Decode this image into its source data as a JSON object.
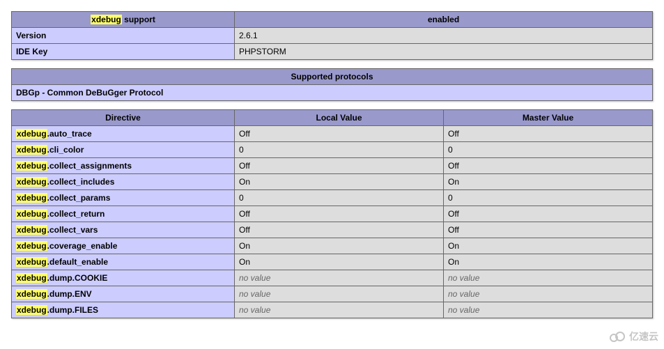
{
  "hl_prefix": "xdebug",
  "support_table": {
    "header_left_suffix": " support",
    "header_right": "enabled",
    "rows": [
      {
        "key": "Version",
        "value": "2.6.1"
      },
      {
        "key": "IDE Key",
        "value": "PHPSTORM"
      }
    ]
  },
  "protocols_table": {
    "header": "Supported protocols",
    "row": "DBGp - Common DeBuGger Protocol"
  },
  "directives_table": {
    "headers": [
      "Directive",
      "Local Value",
      "Master Value"
    ],
    "rows": [
      {
        "suffix": ".auto_trace",
        "local": "Off",
        "master": "Off"
      },
      {
        "suffix": ".cli_color",
        "local": "0",
        "master": "0"
      },
      {
        "suffix": ".collect_assignments",
        "local": "Off",
        "master": "Off"
      },
      {
        "suffix": ".collect_includes",
        "local": "On",
        "master": "On"
      },
      {
        "suffix": ".collect_params",
        "local": "0",
        "master": "0"
      },
      {
        "suffix": ".collect_return",
        "local": "Off",
        "master": "Off"
      },
      {
        "suffix": ".collect_vars",
        "local": "Off",
        "master": "Off"
      },
      {
        "suffix": ".coverage_enable",
        "local": "On",
        "master": "On"
      },
      {
        "suffix": ".default_enable",
        "local": "On",
        "master": "On"
      },
      {
        "suffix": ".dump.COOKIE",
        "local": "no value",
        "master": "no value",
        "italic": true
      },
      {
        "suffix": ".dump.ENV",
        "local": "no value",
        "master": "no value",
        "italic": true
      },
      {
        "suffix": ".dump.FILES",
        "local": "no value",
        "master": "no value",
        "italic": true
      }
    ]
  },
  "watermark": "亿速云"
}
